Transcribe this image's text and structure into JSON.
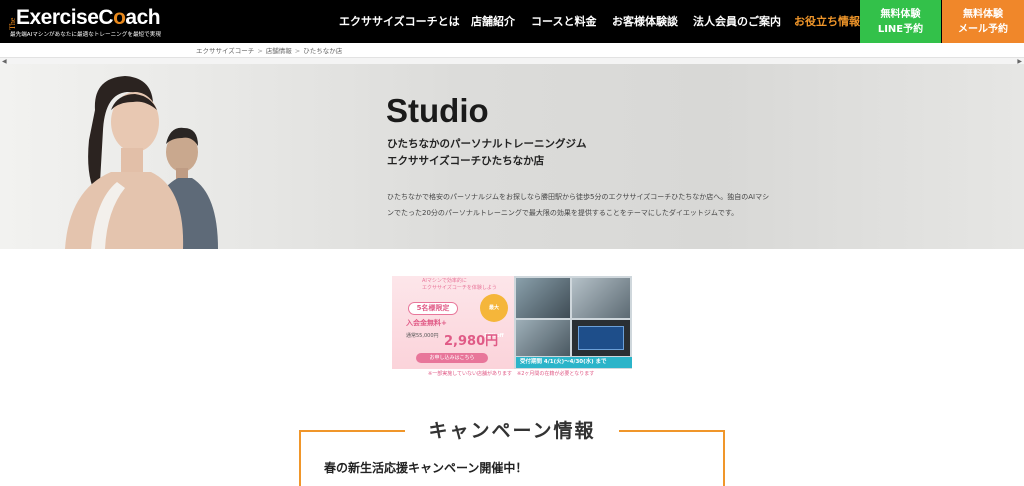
{
  "header": {
    "logo": {
      "prefix": "The",
      "brand_part1": "Exercise",
      "brand_part2": "C",
      "brand_o": "o",
      "brand_part3": "ach",
      "tagline": "最先端AIマシンがあなたに最適なトレーニングを最短で実現"
    },
    "nav": [
      {
        "label": "エクササイズコーチとは"
      },
      {
        "label": "店舗紹介"
      },
      {
        "label": "コースと料金"
      },
      {
        "label": "お客様体験談"
      },
      {
        "label": "法人会員のご案内"
      },
      {
        "label": "お役立ち情報",
        "active": true
      }
    ],
    "cta_line": {
      "line1": "無料体験",
      "line2": "LINE予約"
    },
    "cta_mail": {
      "line1": "無料体験",
      "line2": "メール予約"
    },
    "colors": {
      "background": "#000000",
      "active": "#f0962a",
      "line": "#33c14a",
      "mail": "#f0872a"
    }
  },
  "breadcrumb": {
    "items": [
      "エクササイズコーチ",
      "店舗情報",
      "ひたちなか店"
    ],
    "separator": ">"
  },
  "hero": {
    "title": "Studio",
    "subtitle_line1": "ひたちなかのパーソナルトレーニングジム",
    "subtitle_line2": "エクササイズコーチひたちなか店",
    "description": "ひたちなかで格安のパーソナルジムをお探しなら勝田駅から徒歩5分のエクササイズコーチひたちなか店へ。独自のAIマシンでたった20分のパーソナルトレーニングで最大限の効果を提供することをテーマにしたダイエットジムです。"
  },
  "banner": {
    "headline": "AIマシンで効率的に\nエクササイズコーチを体験しよう",
    "limit": "5名様限定",
    "badge": "最大95%off",
    "fee": "入会金無料+",
    "regular_price": "通常55,000円",
    "campaign_price": "2,980円",
    "apply": "お申し込みはこちら",
    "period": "受付期間 4/1(火)～4/30(水) まで",
    "note": "※一部実施していない店舗があります　※2ヶ月間の在籍が必要となります"
  },
  "campaign": {
    "section_title": "キャンペーン情報",
    "headline": "春の新生活応援キャンペーン開催中！"
  }
}
